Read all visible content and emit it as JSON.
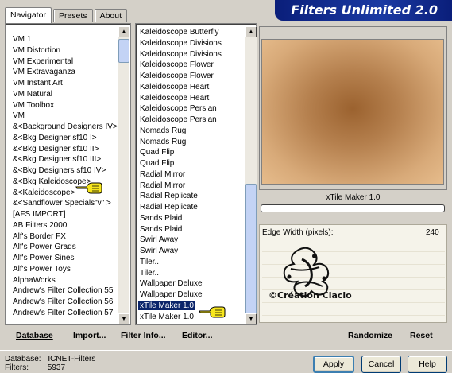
{
  "window": {
    "title": "Filters Unlimited 2.0"
  },
  "tabs": [
    {
      "label": "Navigator"
    },
    {
      "label": "Presets"
    },
    {
      "label": "About"
    }
  ],
  "categories": {
    "items": [
      "VM 1",
      "VM Distortion",
      "VM Experimental",
      "VM Extravaganza",
      "VM Instant Art",
      "VM Natural",
      "VM Toolbox",
      "VM",
      "&<Background Designers IV>",
      "&<Bkg Designer sf10 I>",
      "&<Bkg Designer sf10 II>",
      "&<Bkg Designer sf10 III>",
      "&<Bkg Designers sf10 IV>",
      "&<Bkg Kaleidoscope>",
      "&<Kaleidoscope>",
      "&<Sandflower Specials\"v\" >",
      "[AFS IMPORT]",
      "AB Filters 2000",
      "Alf's Border FX",
      "Alf's Power Grads",
      "Alf's Power Sines",
      "Alf's Power Toys",
      "AlphaWorks",
      "Andrew's Filter Collection 55",
      "Andrew's Filter Collection 56",
      "Andrew's Filter Collection 57"
    ]
  },
  "filters": {
    "items": [
      "Kaleidoscope Butterfly",
      "Kaleidoscope Divisions",
      "Kaleidoscope Divisions",
      "Kaleidoscope Flower",
      "Kaleidoscope Flower",
      "Kaleidoscope Heart",
      "Kaleidoscope Heart",
      "Kaleidoscope Persian",
      "Kaleidoscope Persian",
      "Nomads Rug",
      "Nomads Rug",
      "Quad Flip",
      "Quad Flip",
      "Radial Mirror",
      "Radial Mirror",
      "Radial Replicate",
      "Radial Replicate",
      "Sands Plaid",
      "Sands Plaid",
      "Swirl Away",
      "Swirl Away",
      "Tiler...",
      "Tiler...",
      "Wallpaper Deluxe",
      "Wallpaper Deluxe",
      "xTile Maker 1.0",
      "xTile Maker 1.0"
    ],
    "selected": "xTile Maker 1.0"
  },
  "preview": {
    "filter_name": "xTile Maker 1.0"
  },
  "parameters": [
    {
      "label": "Edge Width (pixels):",
      "value": "240"
    }
  ],
  "watermark": {
    "text": "©Création Ciaclo"
  },
  "toolbar": {
    "database": "Database",
    "import": "Import...",
    "filter_info": "Filter Info...",
    "editor": "Editor...",
    "randomize": "Randomize",
    "reset": "Reset"
  },
  "status": {
    "database_label": "Database:",
    "database_value": "ICNET-Filters",
    "filters_label": "Filters:",
    "filters_value": "5937"
  },
  "buttons": {
    "apply": "Apply",
    "cancel": "Cancel",
    "help": "Help"
  }
}
